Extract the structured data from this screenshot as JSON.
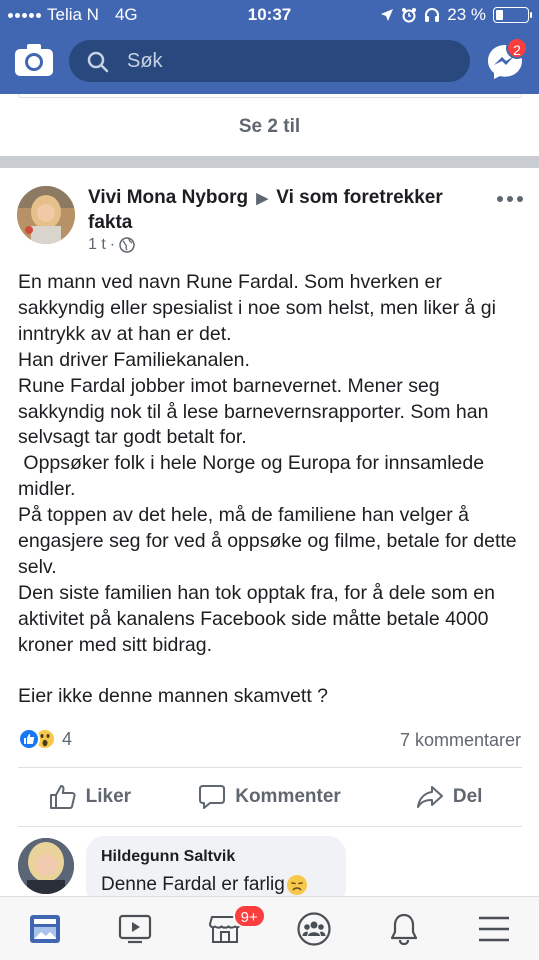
{
  "status_bar": {
    "carrier": "Telia N",
    "network": "4G",
    "time": "10:37",
    "battery_percent": "23 %",
    "battery_level": 0.23
  },
  "header": {
    "search_placeholder": "Søk",
    "messenger_badge": "2",
    "brand_color": "#4267b2"
  },
  "previous_post": {
    "see_more_label": "Se 2 til"
  },
  "post": {
    "author": "Vivi Mona Nyborg",
    "group": "Vi som foretrekker fakta",
    "time_ago": "1 t",
    "dot": "·",
    "privacy_icon": "globe-icon",
    "paragraphs": [
      "En mann ved navn Rune Fardal. Som hverken er sakkyndig eller spesialist i noe som helst, men liker å gi inntrykk av at han er det.",
      "Han driver Familiekanalen.",
      "Rune Fardal jobber imot barnevernet. Mener seg sakkyndig nok til å lese barnevernsrapporter. Som han selvsagt tar godt betalt for.",
      " Oppsøker folk i hele Norge og Europa for innsamlede midler.",
      "På toppen av det hele, må de familiene han velger å engasjere seg for ved å oppsøke og filme, betale for dette selv.",
      "Den siste familien han tok opptak fra, for å dele som en aktivitet på kanalens Facebook side måtte betale 4000 kroner med sitt bidrag.",
      "",
      "Eier ikke denne mannen skamvett ?"
    ],
    "reaction_count": "4",
    "reaction_icons": [
      "like-icon",
      "wow-icon"
    ],
    "comment_count": "7 kommentarer"
  },
  "actions": {
    "like": "Liker",
    "comment": "Kommenter",
    "share": "Del"
  },
  "comment": {
    "author": "Hildegunn Saltvik",
    "text": "Denne Fardal er farlig",
    "emoji": "sad-face-emoji"
  },
  "bottom_nav": {
    "marketplace_badge": "9+",
    "items": [
      "news-feed-icon",
      "watch-icon",
      "marketplace-icon",
      "groups-icon",
      "notifications-icon",
      "menu-icon"
    ]
  }
}
